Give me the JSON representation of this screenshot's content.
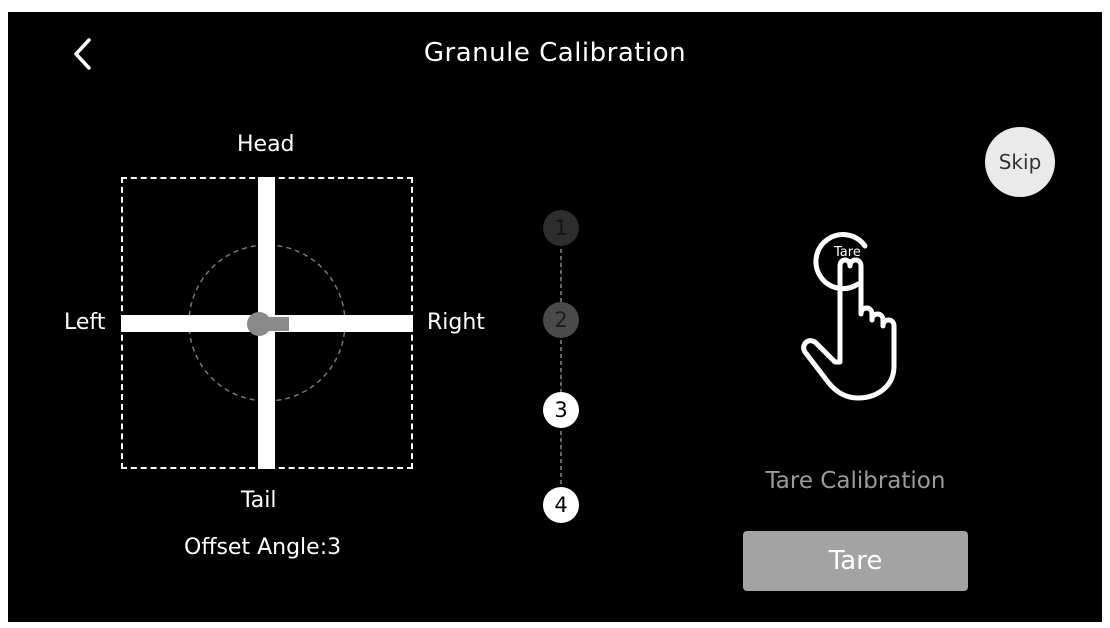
{
  "header": {
    "title": "Granule Calibration"
  },
  "diagram": {
    "head": "Head",
    "tail": "Tail",
    "left": "Left",
    "right": "Right",
    "offset_label": "Offset Angle:3"
  },
  "skip_label": "Skip",
  "steps": [
    {
      "label": "1",
      "state": "done"
    },
    {
      "label": "2",
      "state": "done"
    },
    {
      "label": "3",
      "state": "pending"
    },
    {
      "label": "4",
      "state": "pending"
    }
  ],
  "illustration": {
    "badge": "Tare",
    "icon": "hand-tap-icon"
  },
  "tare_calibration_label": "Tare Calibration",
  "tare_button_label": "Tare"
}
